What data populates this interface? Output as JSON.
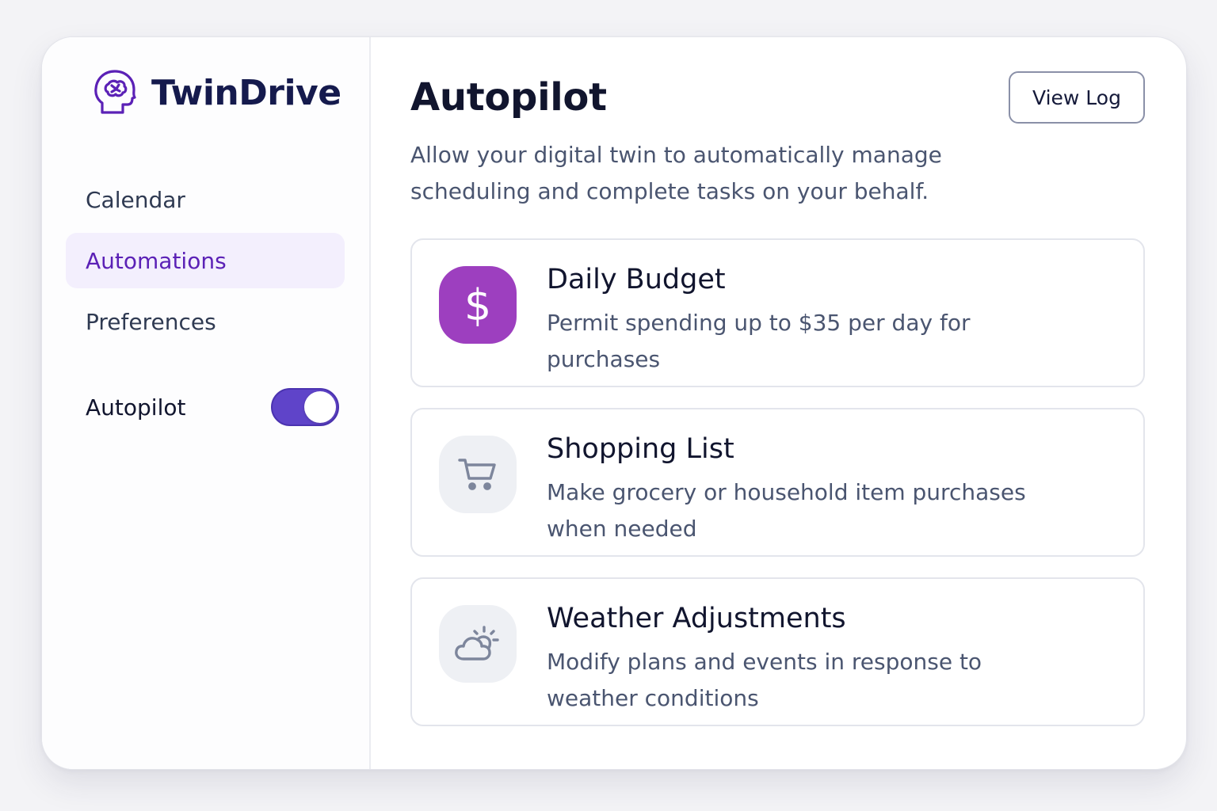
{
  "brand": {
    "name": "TwinDrive",
    "icon": "brain-head-icon",
    "color": "#5b21b6"
  },
  "sidebar": {
    "items": [
      {
        "label": "Calendar",
        "active": false
      },
      {
        "label": "Automations",
        "active": true
      },
      {
        "label": "Preferences",
        "active": false
      }
    ],
    "toggle": {
      "label": "Autopilot",
      "on": true,
      "color": "#5f44c9"
    }
  },
  "main": {
    "title": "Autopilot",
    "subtitle": "Allow your digital twin to automatically manage scheduling and complete tasks on your behalf.",
    "view_log_label": "View Log",
    "cards": [
      {
        "icon": "dollar-icon",
        "icon_glyph": "$",
        "icon_bg": "#9d3fbf",
        "title": "Daily Budget",
        "description": "Permit spending up to $35 per day for purchases"
      },
      {
        "icon": "cart-icon",
        "icon_bg": "#eef0f4",
        "title": "Shopping List",
        "description": "Make grocery or household item purchases when needed"
      },
      {
        "icon": "cloud-sun-icon",
        "icon_bg": "#eef0f4",
        "title": "Weather Adjustments",
        "description": "Modify plans and events in response to weather conditions"
      }
    ]
  }
}
